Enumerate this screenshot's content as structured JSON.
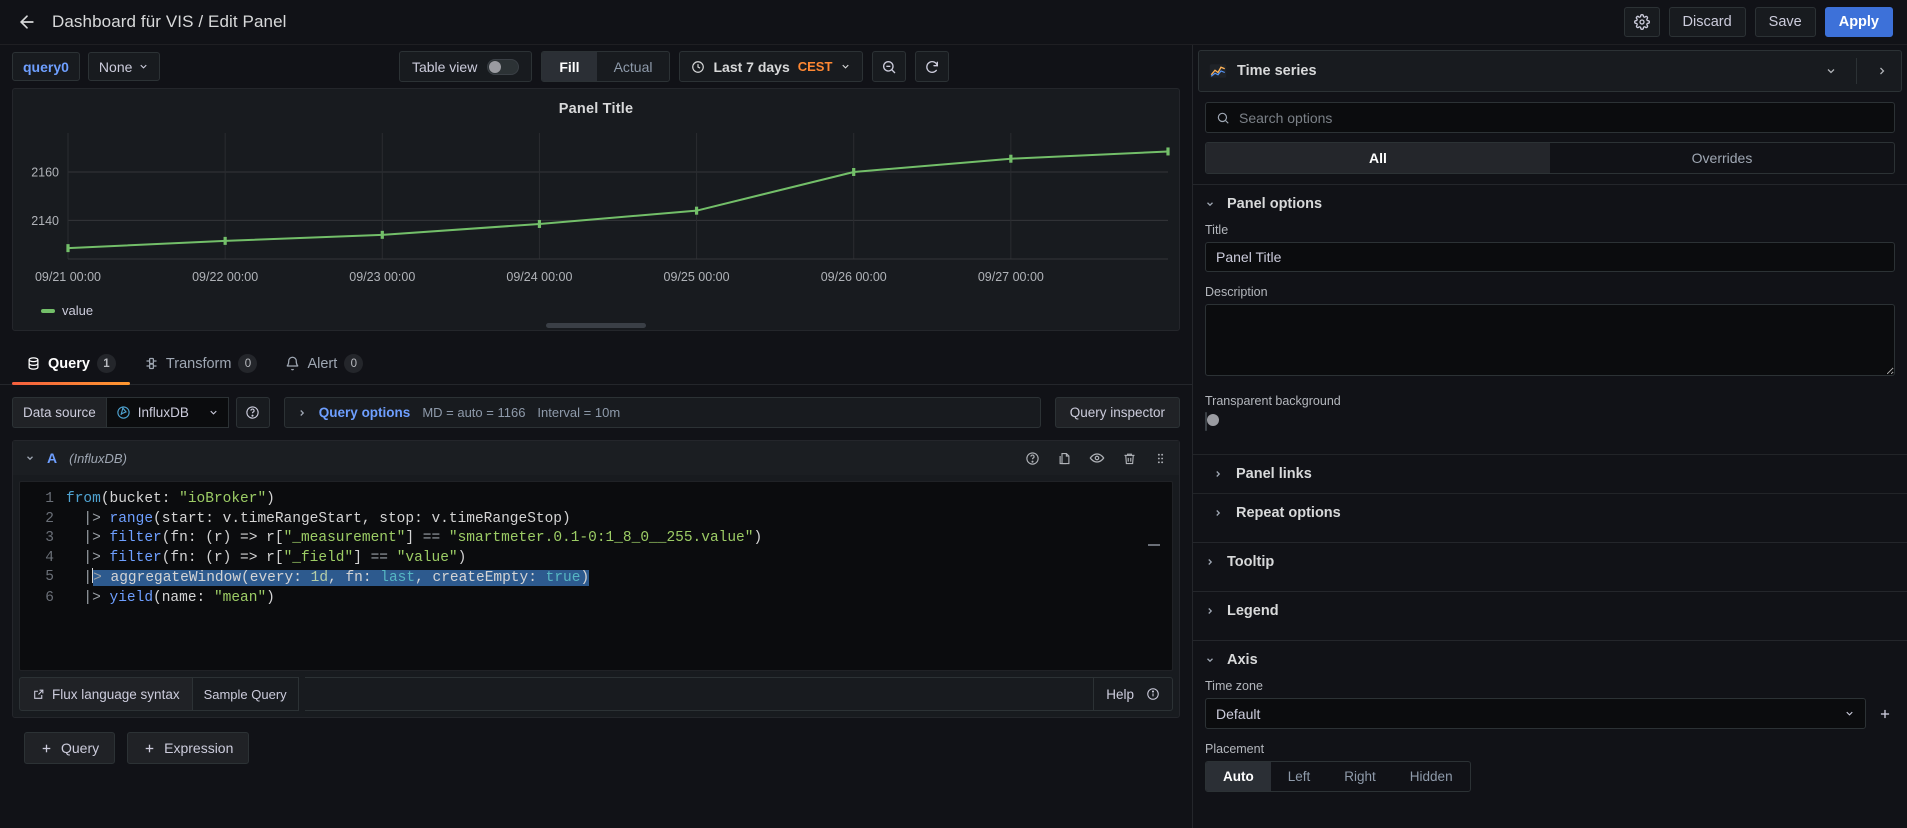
{
  "topbar": {
    "back_icon": "arrow-left-icon",
    "breadcrumb": "Dashboard für VIS / Edit Panel",
    "settings_icon": "gear-icon",
    "discard_label": "Discard",
    "save_label": "Save",
    "apply_label": "Apply",
    "apply_color": "#3d71d9"
  },
  "viz_toolbar": {
    "query_chip": "query0",
    "none_select": "None",
    "table_view_label": "Table view",
    "table_view_on": false,
    "fill_actual": {
      "options": [
        "Fill",
        "Actual"
      ],
      "selected": "Fill"
    },
    "time_range": "Last 7 days",
    "timezone": "CEST",
    "timezone_color": "#ff8833",
    "zoom_out_icon": "zoom-out-icon",
    "refresh_icon": "refresh-icon",
    "clock_icon": "clock-icon"
  },
  "panel": {
    "title": "Panel Title",
    "legend": "value",
    "series_color": "#73bf69"
  },
  "chart_data": {
    "type": "line",
    "title": "Panel Title",
    "xlabel": "",
    "ylabel": "",
    "grid": true,
    "legend_position": "bottom-left",
    "series": [
      {
        "name": "value",
        "color": "#73bf69",
        "x": [
          "09/21 00:00",
          "09/22 00:00",
          "09/23 00:00",
          "09/24 00:00",
          "09/25 00:00",
          "09/26 00:00",
          "09/27 00:00",
          "09/28 00:00"
        ],
        "values": [
          2128.5,
          2131.5,
          2134.0,
          2138.5,
          2144.0,
          2160.0,
          2165.5,
          2168.5
        ]
      }
    ],
    "xticks": [
      "09/21 00:00",
      "09/22 00:00",
      "09/23 00:00",
      "09/24 00:00",
      "09/25 00:00",
      "09/26 00:00",
      "09/27 00:00"
    ],
    "yticks": [
      2140,
      2160
    ],
    "ylim": [
      2124,
      2172
    ]
  },
  "tabs": [
    {
      "label": "Query",
      "count": "1",
      "icon": "database-icon",
      "active": true
    },
    {
      "label": "Transform",
      "count": "0",
      "icon": "transform-icon",
      "active": false
    },
    {
      "label": "Alert",
      "count": "0",
      "icon": "bell-icon",
      "active": false
    }
  ],
  "query_options": {
    "data_source_label": "Data source",
    "data_source_value": "InfluxDB",
    "help_icon": "question-circle-icon",
    "expand_icon": "chevron-right-icon",
    "query_options_label": "Query options",
    "md_meta": "MD = auto = 1166",
    "interval_meta": "Interval = 10m",
    "query_inspector_label": "Query inspector"
  },
  "query_editor": {
    "ref_id": "A",
    "datasource_note": "(InfluxDB)",
    "icons": [
      "help-circle-icon",
      "duplicate-icon",
      "eye-icon",
      "trash-icon",
      "drag-handle-icon"
    ],
    "code_lines": [
      {
        "n": "1",
        "text": "from(bucket: \"ioBroker\")"
      },
      {
        "n": "2",
        "text": "  |> range(start: v.timeRangeStart, stop: v.timeRangeStop)"
      },
      {
        "n": "3",
        "text": "  |> filter(fn: (r) => r[\"_measurement\"] == \"smartmeter.0.1-0:1_8_0__255.value\")"
      },
      {
        "n": "4",
        "text": "  |> filter(fn: (r) => r[\"_field\"] == \"value\")"
      },
      {
        "n": "5",
        "text": "  |> aggregateWindow(every: 1d, fn: last, createEmpty: true)"
      },
      {
        "n": "6",
        "text": "  |> yield(name: \"mean\")"
      }
    ],
    "selected_line": "5",
    "flux_syntax_label": "Flux language syntax",
    "sample_query_label": "Sample Query",
    "help_label": "Help",
    "external_link_icon": "external-link-icon",
    "info_icon": "info-circle-icon"
  },
  "add_row": {
    "query_label": "Query",
    "expression_label": "Expression",
    "plus_icon": "plus-icon"
  },
  "options_pane": {
    "viz_type": "Time series",
    "viz_icon": "timeseries-icon",
    "collapse_icon": "chevron-down-icon",
    "expand_pane_icon": "chevron-right-icon",
    "search_placeholder": "Search options",
    "search_value": "",
    "search_icon": "search-icon",
    "tabs": {
      "options": [
        "All",
        "Overrides"
      ],
      "selected": "All"
    },
    "panel_options": {
      "header": "Panel options",
      "expanded": true,
      "title_label": "Title",
      "title_value": "Panel Title",
      "description_label": "Description",
      "description_value": "",
      "transparent_label": "Transparent background",
      "transparent_on": false,
      "sub_sections": [
        "Panel links",
        "Repeat options"
      ]
    },
    "sections": [
      {
        "header": "Tooltip",
        "expanded": false
      },
      {
        "header": "Legend",
        "expanded": false
      }
    ],
    "axis": {
      "header": "Axis",
      "expanded": true,
      "time_zone_label": "Time zone",
      "time_zone_value": "Default",
      "placement_label": "Placement",
      "placement_options": [
        "Auto",
        "Left",
        "Right",
        "Hidden"
      ],
      "placement_selected": "Auto"
    }
  }
}
